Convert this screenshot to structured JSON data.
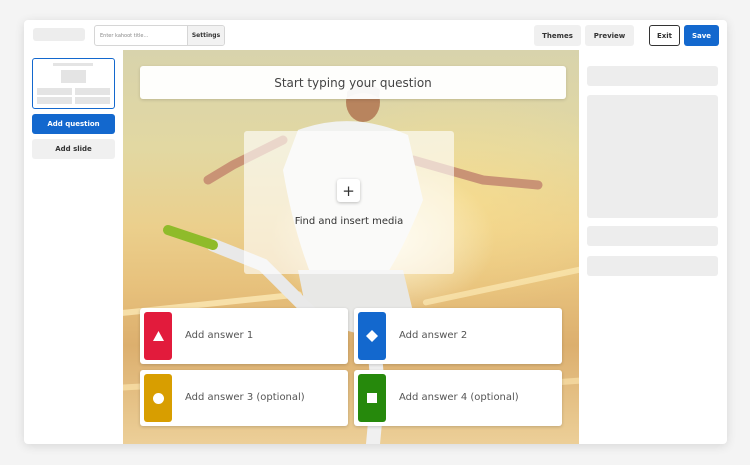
{
  "header": {
    "title_placeholder": "Enter kahoot title...",
    "settings_label": "Settings",
    "themes_label": "Themes",
    "preview_label": "Preview",
    "exit_label": "Exit",
    "save_label": "Save"
  },
  "sidebar": {
    "add_question_label": "Add question",
    "add_slide_label": "Add slide"
  },
  "editor": {
    "question_placeholder": "Start typing your question",
    "media_label": "Find and insert media",
    "media_icon": "plus-icon",
    "answers": [
      {
        "label": "Add answer 1",
        "color": "#e21b3c",
        "shape": "triangle-icon"
      },
      {
        "label": "Add answer 2",
        "color": "#1368ce",
        "shape": "diamond-icon"
      },
      {
        "label": "Add answer 3 (optional)",
        "color": "#d89e00",
        "shape": "circle-icon"
      },
      {
        "label": "Add answer 4 (optional)",
        "color": "#26890c",
        "shape": "square-icon"
      }
    ]
  },
  "colors": {
    "primary": "#1368ce",
    "placeholder_gray": "#ededed"
  }
}
